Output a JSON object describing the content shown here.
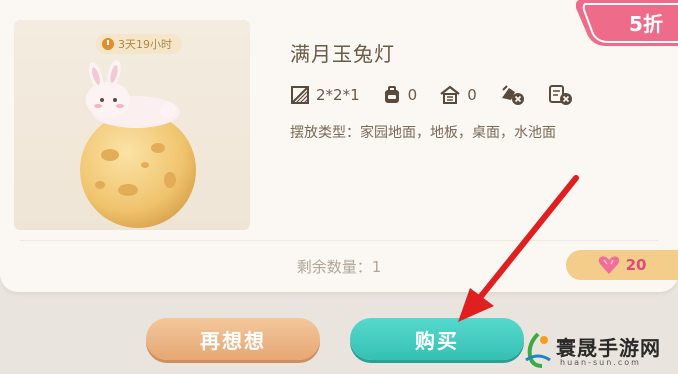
{
  "item": {
    "timer": "3天19小时",
    "name": "满月玉兔灯",
    "size": "2*2*1",
    "stat2": "0",
    "stat3": "0",
    "placement": "摆放类型：家园地面，地板，桌面，水池面",
    "remaining": "剩余数量：1"
  },
  "discount": {
    "label": "5折"
  },
  "price": {
    "value": "20",
    "icon": "heart-gem-icon"
  },
  "buttons": {
    "think": "再想想",
    "buy": "购买"
  },
  "watermark": {
    "name": "寰晟手游网",
    "sub": "huan-sun.com"
  },
  "colors": {
    "buy": "#3cc7bb",
    "think": "#eab384",
    "price_bg": "#f3cd8a",
    "discount": "#ee6b8a",
    "arrow": "#e02020"
  }
}
